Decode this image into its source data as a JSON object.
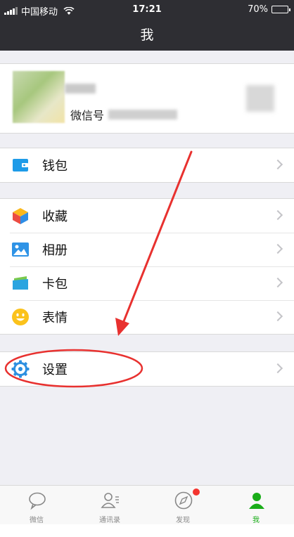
{
  "status_bar": {
    "carrier": "中国移动",
    "time": "17:21",
    "battery_percent": "70%",
    "battery_level": 0.7
  },
  "nav": {
    "title": "我"
  },
  "profile": {
    "wechat_id_label": "微信号"
  },
  "menu_groups": [
    [
      {
        "label": "钱包",
        "icon": "wallet-icon"
      }
    ],
    [
      {
        "label": "收藏",
        "icon": "favorites-icon"
      },
      {
        "label": "相册",
        "icon": "album-icon"
      },
      {
        "label": "卡包",
        "icon": "card-icon"
      },
      {
        "label": "表情",
        "icon": "sticker-icon"
      }
    ],
    [
      {
        "label": "设置",
        "icon": "settings-icon"
      }
    ]
  ],
  "tab_bar": [
    {
      "label": "微信",
      "icon": "chat-icon"
    },
    {
      "label": "通讯录",
      "icon": "contacts-icon"
    },
    {
      "label": "发现",
      "icon": "discover-icon"
    },
    {
      "label": "我",
      "icon": "me-icon"
    }
  ],
  "colors": {
    "nav_bg": "#2e2e33",
    "accent_green": "#1aad19",
    "badge_red": "#f43530",
    "annotation_red": "#e8312f"
  }
}
